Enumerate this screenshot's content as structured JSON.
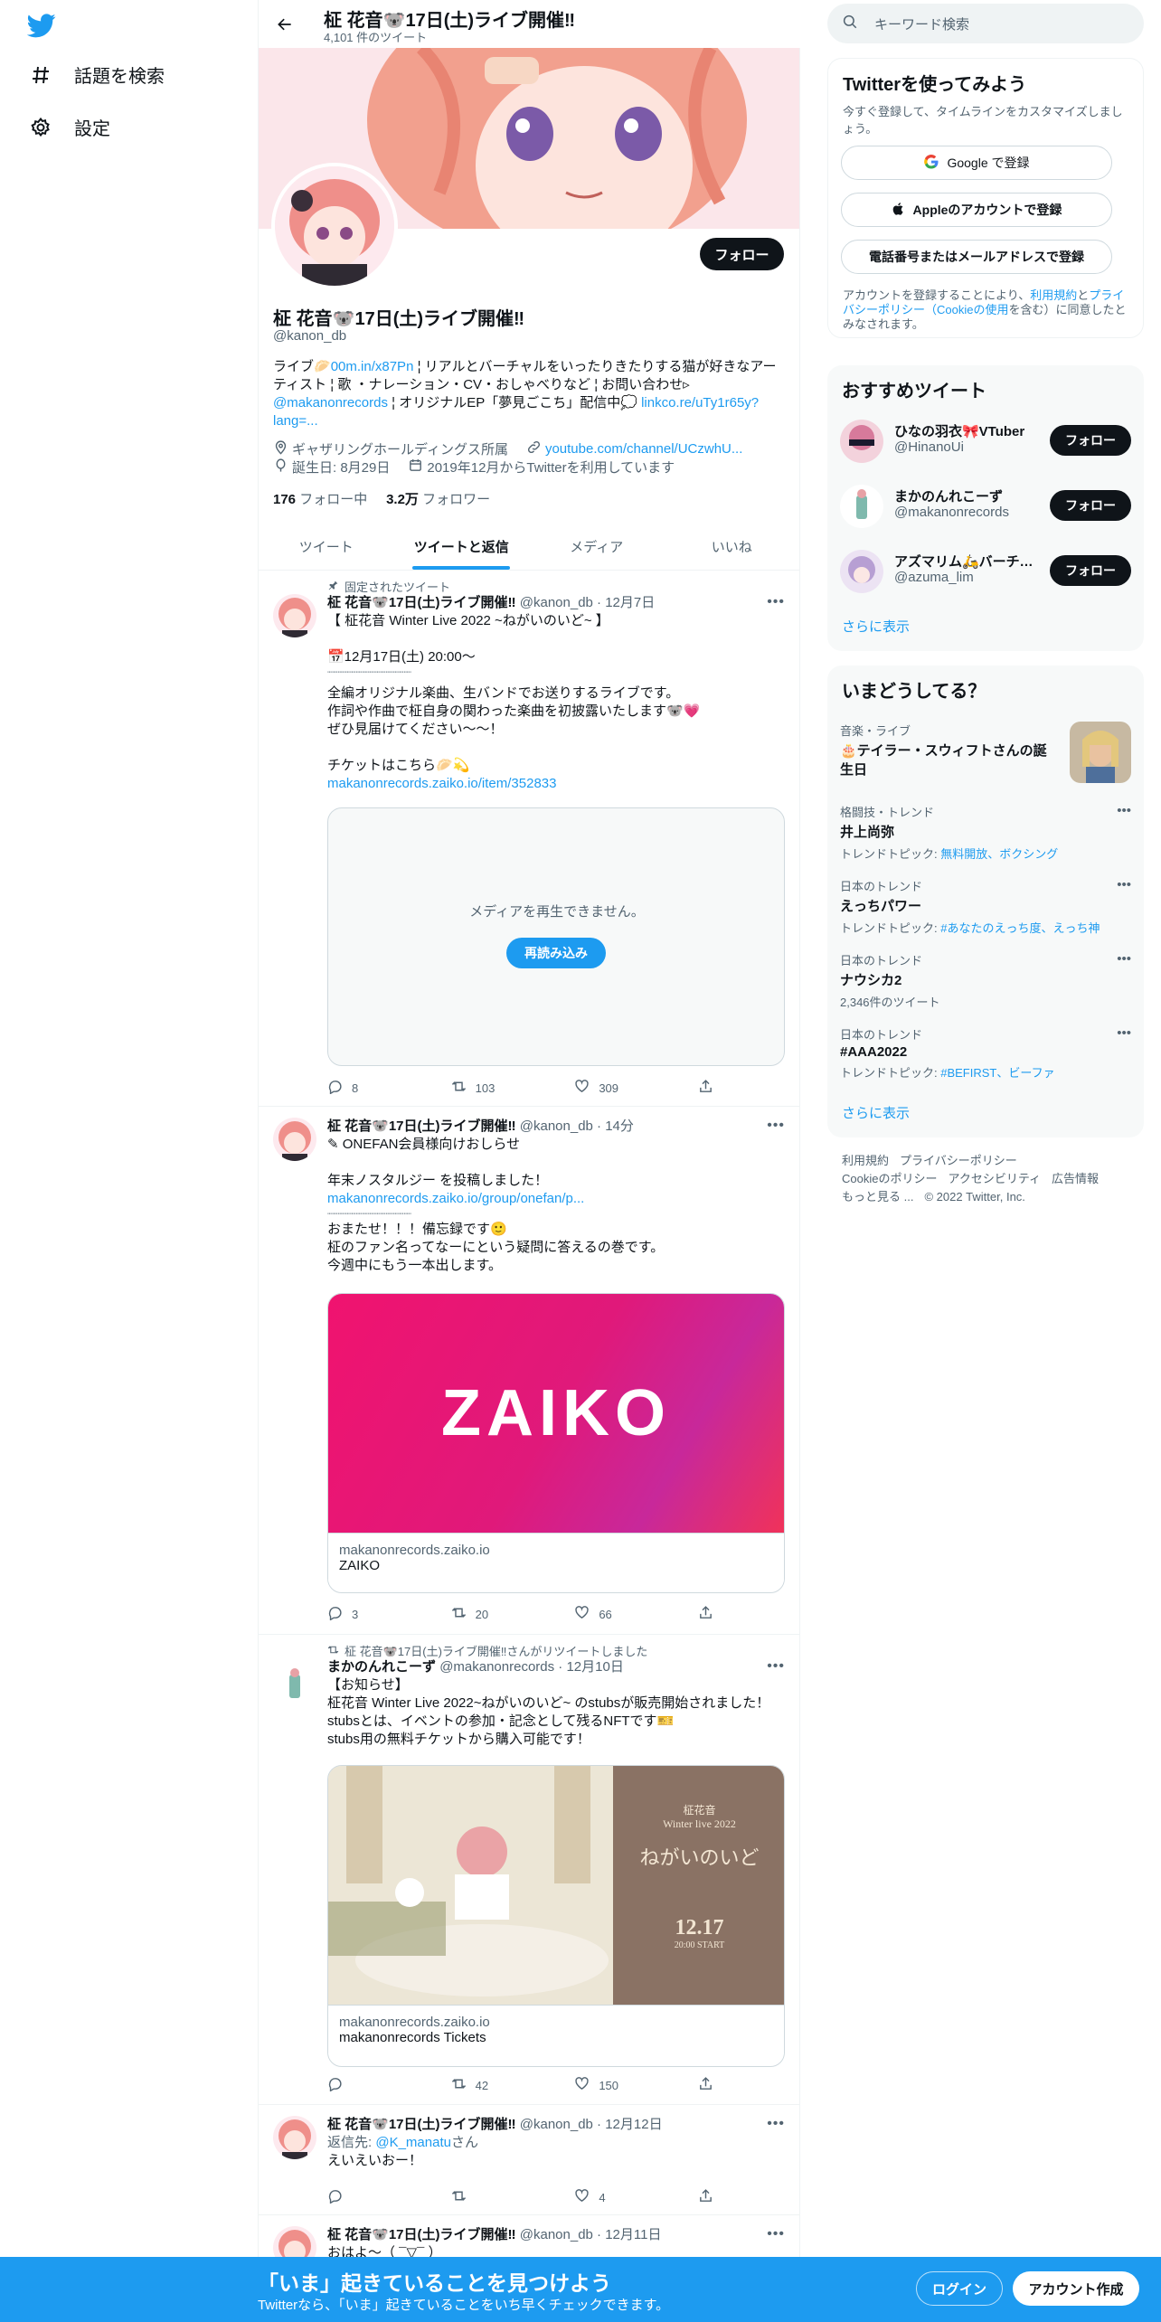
{
  "nav": {
    "explore_label": "話題を検索",
    "settings_label": "設定"
  },
  "header": {
    "title": "柾 花音🐨17日(土)ライブ開催‼",
    "tweet_count": "4,101 件のツイート"
  },
  "profile": {
    "follow_label": "フォロー",
    "name": "柾 花音🐨17日(土)ライブ開催‼",
    "handle": "@kanon_db",
    "bio_1": "ライブ🥟",
    "bio_link1": "00m.in/x87Pn",
    "bio_2": "¦ リアルとバーチャルをいったりきたりする猫が好きなアーティスト ¦ 歌 ・ナレーション・CV・おしゃべりなど ¦ お問い合わせ▹",
    "bio_mention": "@makanonrecords",
    "bio_3": "¦ オリジナルEP「夢見ごこち」配信中💭",
    "bio_link2": "linkco.re/uTy1r65y?lang=...",
    "location": "ギャザリングホールディングス所属",
    "website": "youtube.com/channel/UCzwhU...",
    "birthday": "誕生日: 8月29日",
    "joined": "2019年12月からTwitterを利用しています",
    "following_count": "176",
    "following_label": "フォロー中",
    "followers_count": "3.2万",
    "followers_label": "フォロワー"
  },
  "tabs": [
    "ツイート",
    "ツイートと返信",
    "メディア",
    "いいね"
  ],
  "tweets": [
    {
      "pinned_label": "固定されたツイート",
      "name": "柾 花音🐨17日(土)ライブ開催‼",
      "handle_time": "@kanon_db · 12月7日",
      "line1": "【 柾花音 Winter Live 2022 ~ねがいのいど~ 】",
      "line2": "📅12月17日(土) 20:00〜",
      "line3": "┈┈┈┈┈┈┈┈┈┈┈┈┈┈",
      "line4": "全編オリジナル楽曲、生バンドでお送りするライブです。",
      "line5": "作詞や作曲で柾自身の関わった楽曲を初披露いたします🐨💗",
      "line6": "ぜひ見届けてください〜〜！",
      "line7": "チケットはこちら🥟💫",
      "link": "makanonrecords.zaiko.io/item/352833",
      "media_error": "メディアを再生できません。",
      "reload_label": "再読み込み",
      "replies": "8",
      "retweets": "103",
      "likes": "309"
    },
    {
      "name": "柾 花音🐨17日(土)ライブ開催‼",
      "handle_time": "@kanon_db · 14分",
      "line1": "✎ ONEFAN会員様向けおしらせ",
      "line2": "年末ノスタルジー を投稿しました！",
      "link": "makanonrecords.zaiko.io/group/onefan/p...",
      "line3": "┈┈┈┈┈┈┈┈┈┈┈┈┈┈",
      "line4": "おまたせ！！！備忘録です🙂",
      "line5": "柾のファン名ってなーにという疑問に答えるの巻です。",
      "line6": "今週中にもう一本出します。",
      "card_logo": "ZAIKO",
      "card_domain": "makanonrecords.zaiko.io",
      "card_title": "ZAIKO",
      "replies": "3",
      "retweets": "20",
      "likes": "66"
    },
    {
      "retweet_label": "柾 花音🐨17日(土)ライブ開催‼さんがリツイートしました",
      "name": "まかのんれこーず",
      "handle_time": "@makanonrecords · 12月10日",
      "line1": "【お知らせ】",
      "line2": "柾花音 Winter Live 2022~ねがいのいど~ のstubsが販売開始されました！",
      "line3": "stubsとは、イベントの参加・記念として残るNFTです🎫",
      "line4": "stubs用の無料チケットから購入可能です！",
      "poster_t1": "柾花音",
      "poster_t2": "Winter live 2022",
      "poster_t3": "ねがいのいど",
      "poster_date": "12.17",
      "poster_time": "20:00 START",
      "card_domain": "makanonrecords.zaiko.io",
      "card_title": "makanonrecords Tickets",
      "replies": "",
      "retweets": "42",
      "likes": "150"
    },
    {
      "name": "柾 花音🐨17日(土)ライブ開催‼",
      "handle_time": "@kanon_db · 12月12日",
      "reply_to_label": "返信先: ",
      "reply_to": "@K_manatu",
      "reply_suffix": "さん",
      "line1": "えいえいおー！",
      "replies": "",
      "retweets": "",
      "likes": "4"
    },
    {
      "name": "柾 花音🐨17日(土)ライブ開催‼",
      "handle_time": "@kanon_db · 12月11日",
      "line1": "おはよ〜（ ¯▽¯ ）"
    }
  ],
  "right": {
    "search_placeholder": "キーワード検索",
    "signup": {
      "title": "Twitterを使ってみよう",
      "subtitle": "今すぐ登録して、タイムラインをカスタマイズしましょう。",
      "google": "Google で登録",
      "apple": "Appleのアカウントで登録",
      "phone": "電話番号またはメールアドレスで登録",
      "terms_1": "アカウントを登録することにより、",
      "terms_link1": "利用規約",
      "terms_2": "と",
      "terms_link2": "プライバシーポリシー（Cookieの使用",
      "terms_3": "を含む）に同意したとみなされます。"
    },
    "recommend": {
      "title": "おすすめツイート",
      "users": [
        {
          "name": "ひなの羽衣🎀VTuber",
          "handle": "@HinanoUi"
        },
        {
          "name": "まかのんれこーず",
          "handle": "@makanonrecords"
        },
        {
          "name": "アズマリム🛵バーチャル…",
          "handle": "@azuma_lim"
        }
      ],
      "follow_label": "フォロー",
      "more": "さらに表示"
    },
    "trends": {
      "title": "いまどうしてる？",
      "items": [
        {
          "category": "音楽・ライブ",
          "title": "🎂テイラー・スウィフトさんの誕生日",
          "sub_label": "",
          "sub": ""
        },
        {
          "category": "格闘技・トレンド",
          "title": "井上尚弥",
          "sub_label": "トレンドトピック: ",
          "sub": "無料開放、ボクシング"
        },
        {
          "category": "日本のトレンド",
          "title": "えっちパワー",
          "sub_label": "トレンドトピック: ",
          "sub": "#あなたのえっち度、えっち神"
        },
        {
          "category": "日本のトレンド",
          "title": "ナウシカ2",
          "sub_label": "",
          "sub": "2,346件のツイート"
        },
        {
          "category": "日本のトレンド",
          "title": "#AAA2022",
          "sub_label": "トレンドトピック: ",
          "sub": "#BEFIRST、ビーファ"
        }
      ],
      "more": "さらに表示"
    },
    "footer": {
      "l1": "利用規約",
      "l2": "プライバシーポリシー",
      "l3": "Cookieのポリシー",
      "l4": "アクセシビリティ",
      "l5": "広告情報",
      "l6": "もっと見る ...",
      "copy": "© 2022 Twitter, Inc."
    }
  },
  "bottom": {
    "headline": "「いま」起きていることを見つけよう",
    "sub": "Twitterなら、「いま」起きていることをいち早くチェックできます。",
    "login": "ログイン",
    "signup": "アカウント作成"
  },
  "colors": {
    "accent": "#1d9bf0",
    "text": "#0f1419",
    "muted": "#536471",
    "like": "#f91880"
  }
}
